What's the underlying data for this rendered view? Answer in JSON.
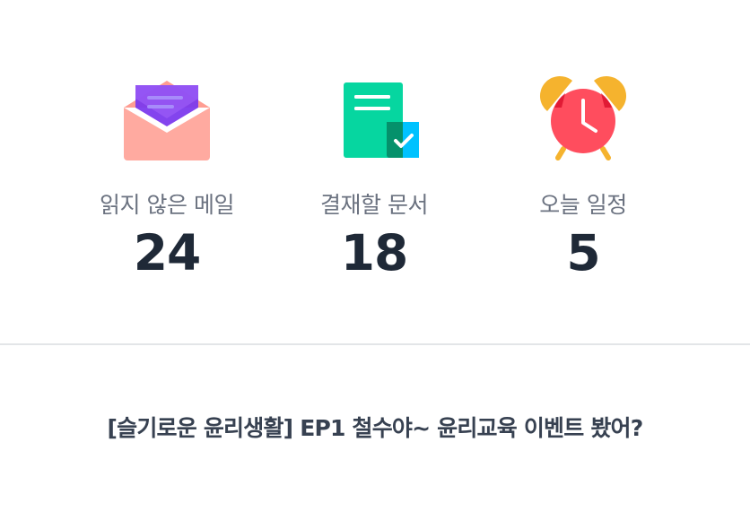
{
  "stats": {
    "unread_mail": {
      "label": "읽지 않은 메일",
      "value": "24",
      "icon": "envelope-icon"
    },
    "approvals": {
      "label": "결재할 문서",
      "value": "18",
      "icon": "document-check-icon"
    },
    "schedule": {
      "label": "오늘 일정",
      "value": "5",
      "icon": "alarm-clock-icon"
    }
  },
  "banner": {
    "text": "[슬기로운 윤리생활] EP1 철수야~ 윤리교육 이벤트 봤어?"
  },
  "colors": {
    "label": "#6b7280",
    "value": "#1f2937",
    "banner": "#374151",
    "divider": "#e3e5e8",
    "envelope_body": "#ffaaa0",
    "envelope_letter": "#6d28d9",
    "document": "#06d6a0",
    "check_badge": "#00c2ff",
    "clock_face": "#ff4d5e",
    "clock_bells": "#f5b32e"
  }
}
